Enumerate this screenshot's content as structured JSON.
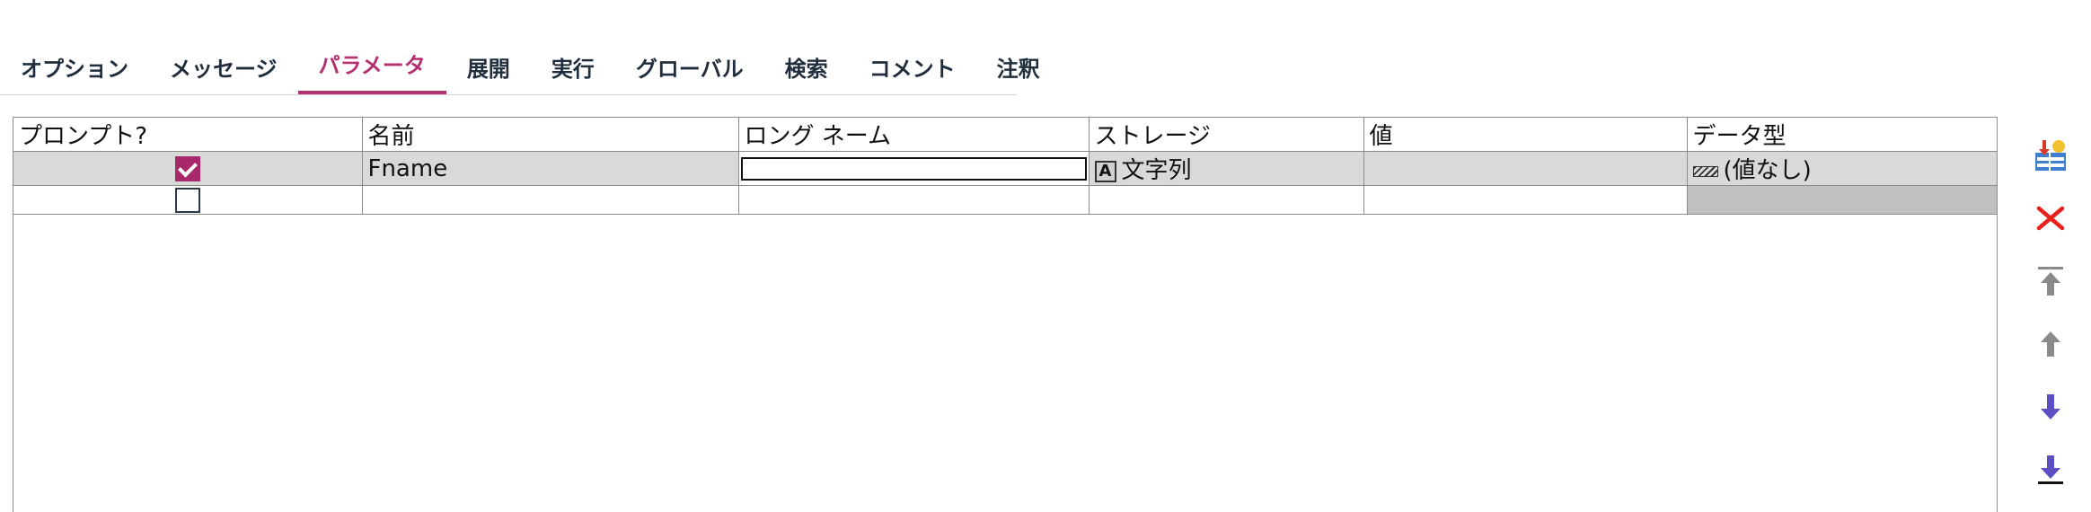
{
  "tabs": [
    {
      "label": "オプション",
      "active": false
    },
    {
      "label": "メッセージ",
      "active": false
    },
    {
      "label": "パラメータ",
      "active": true
    },
    {
      "label": "展開",
      "active": false
    },
    {
      "label": "実行",
      "active": false
    },
    {
      "label": "グローバル",
      "active": false
    },
    {
      "label": "検索",
      "active": false
    },
    {
      "label": "コメント",
      "active": false
    },
    {
      "label": "注釈",
      "active": false
    }
  ],
  "grid": {
    "columns": [
      "プロンプト?",
      "名前",
      "ロング ネーム",
      "ストレージ",
      "値",
      "データ型"
    ],
    "rows": [
      {
        "prompt": true,
        "name": "Fname",
        "long_name": "",
        "storage_icon": "A",
        "storage": "文字列",
        "value": "",
        "datatype": "(値なし)"
      },
      {
        "prompt": false,
        "name": "",
        "long_name": "",
        "storage": "",
        "value": "",
        "datatype": ""
      }
    ]
  },
  "toolbar": {
    "icons": [
      "add-row-icon",
      "delete-icon",
      "move-top-icon",
      "move-up-icon",
      "move-down-icon",
      "move-bottom-icon"
    ]
  },
  "colors": {
    "accent": "#b5306f",
    "checkbox": "#a8296a",
    "delete": "#e8221b",
    "arrow_up": "#8a8a8a",
    "arrow_down": "#5b4fc4"
  }
}
